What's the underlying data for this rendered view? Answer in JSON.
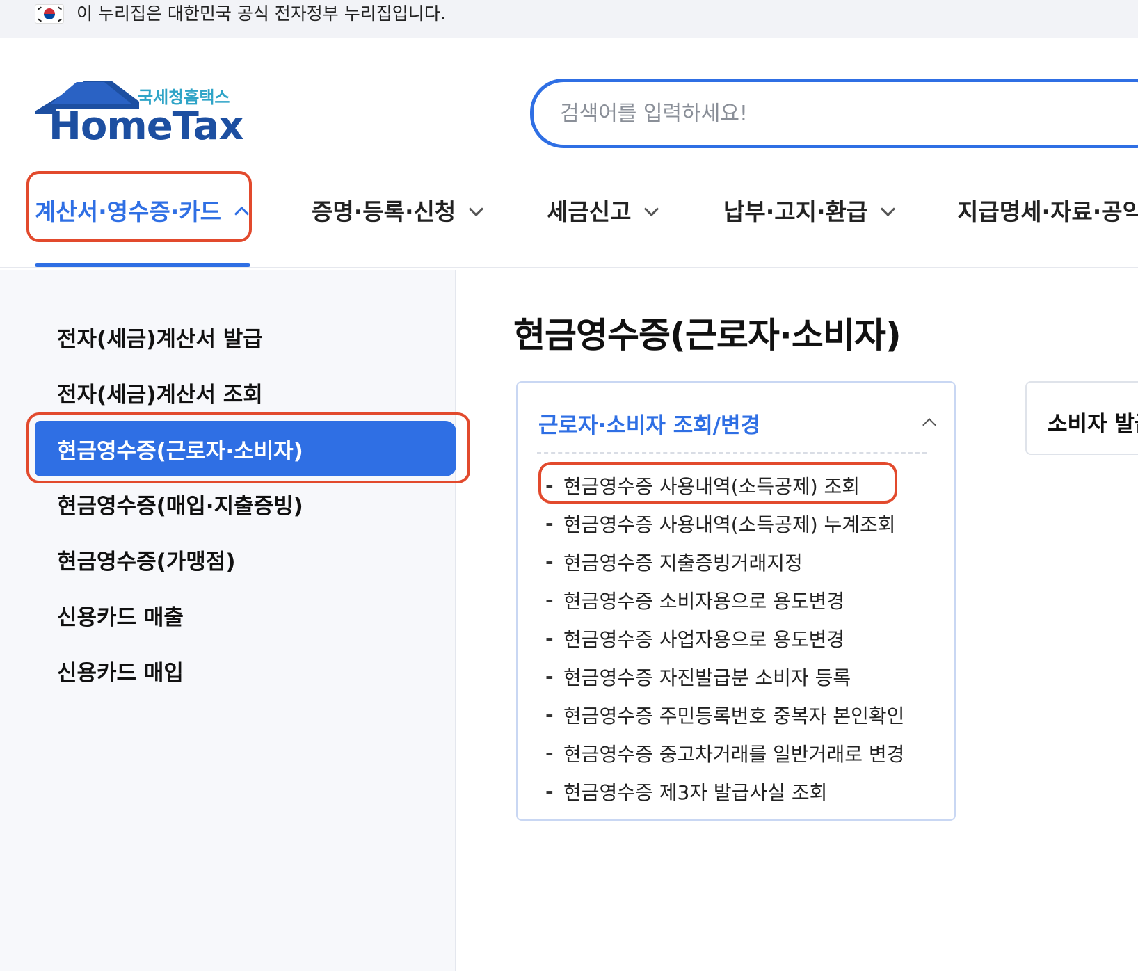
{
  "banner": {
    "text": "이 누리집은 대한민국 공식 전자정부 누리집입니다.",
    "flag_icon": "korean-flag-icon"
  },
  "logo": {
    "subtitle": "국세청홈택스",
    "title": "HomeTax"
  },
  "search": {
    "placeholder": "검색어를 입력하세요!",
    "value": ""
  },
  "gnb": {
    "items": [
      {
        "label": "계산서·영수증·카드",
        "active": true
      },
      {
        "label": "증명·등록·신청"
      },
      {
        "label": "세금신고"
      },
      {
        "label": "납부·고지·환급"
      },
      {
        "label": "지급명세·자료·공익"
      }
    ]
  },
  "lnb": {
    "items": [
      {
        "label": "전자(세금)계산서 발급"
      },
      {
        "label": "전자(세금)계산서 조회"
      },
      {
        "label": "현금영수증(근로자·소비자)",
        "active": true
      },
      {
        "label": "현금영수증(매입·지출증빙)"
      },
      {
        "label": "현금영수증(가맹점)"
      },
      {
        "label": "신용카드 매출"
      },
      {
        "label": "신용카드 매입"
      }
    ]
  },
  "content": {
    "title": "현금영수증(근로자·소비자)",
    "card1": {
      "title": "근로자·소비자 조회/변경",
      "items": [
        "현금영수증 사용내역(소득공제) 조회",
        "현금영수증 사용내역(소득공제) 누계조회",
        "현금영수증 지출증빙거래지정",
        "현금영수증 소비자용으로 용도변경",
        "현금영수증 사업자용으로 용도변경",
        "현금영수증 자진발급분 소비자 등록",
        "현금영수증 주민등록번호 중복자 본인확인",
        "현금영수증 중고차거래를 일반거래로 변경",
        "현금영수증 제3자 발급사실 조회"
      ],
      "dash": "-"
    },
    "card2": {
      "title": "소비자 발급"
    }
  },
  "colors": {
    "accent": "#2f6fe4",
    "highlight": "#e24a2d",
    "logo_blue": "#1d4fa1",
    "logo_sub": "#2fa4c7"
  }
}
